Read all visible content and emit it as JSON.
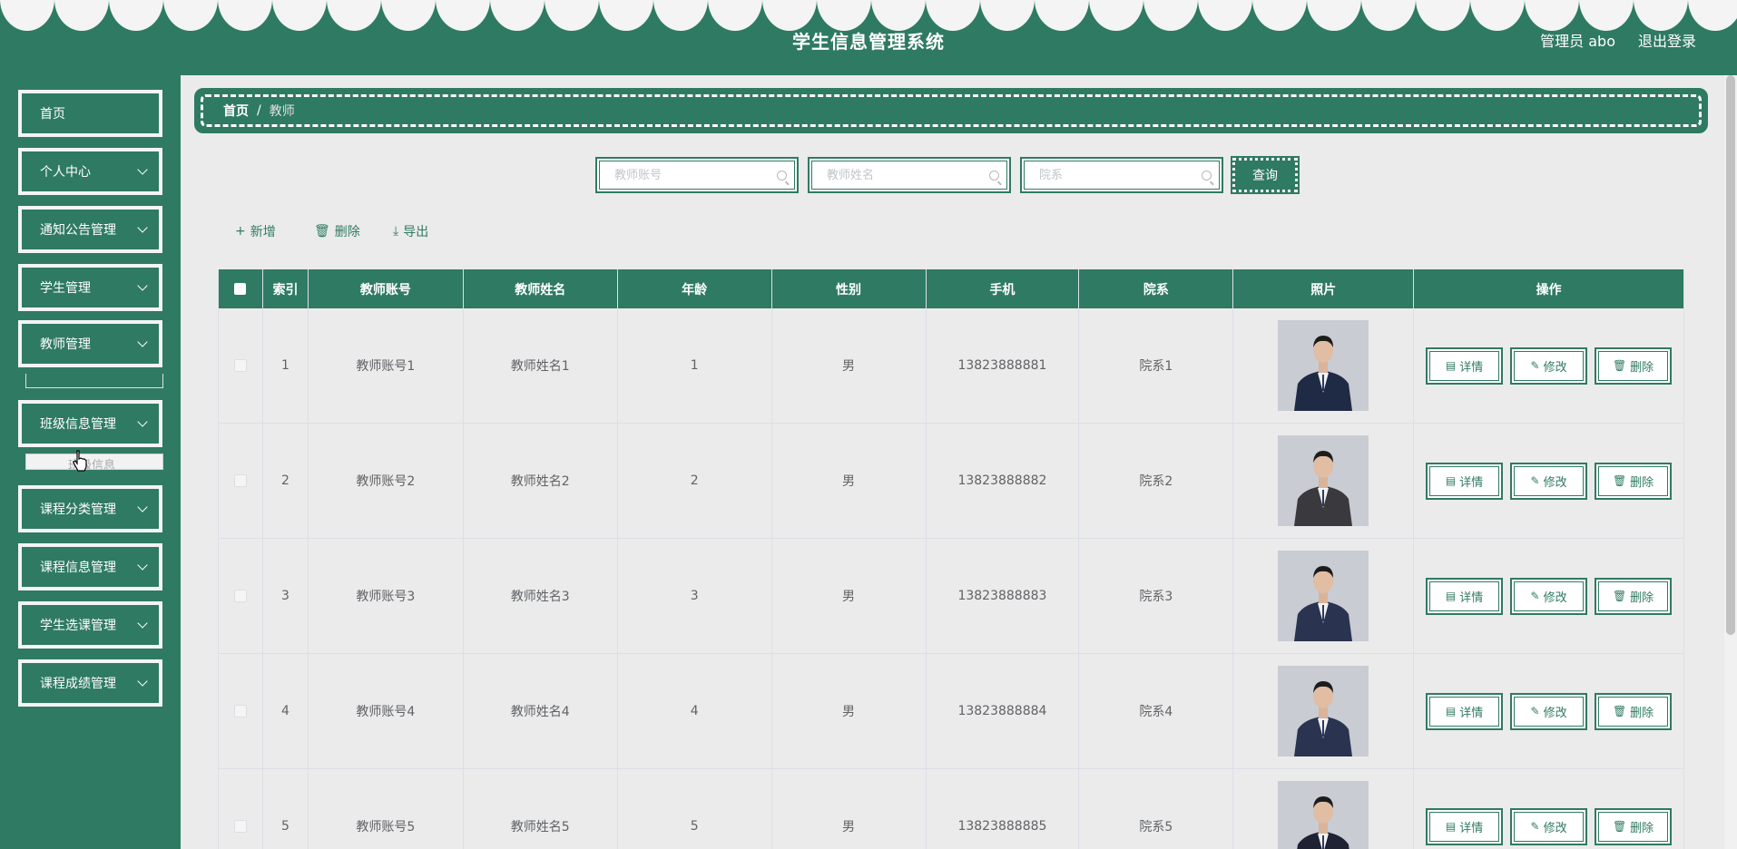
{
  "header": {
    "title": "学生信息管理系统",
    "user": "管理员 abo",
    "logout": "退出登录",
    "color": "#2f7a62"
  },
  "sidebar": {
    "items": [
      {
        "label": "首页",
        "has_arrow": false
      },
      {
        "label": "个人中心",
        "has_arrow": true
      },
      {
        "label": "通知公告管理",
        "has_arrow": true
      },
      {
        "label": "学生管理",
        "has_arrow": true
      },
      {
        "label": "教师管理",
        "has_arrow": true
      },
      {
        "label": "班级信息管理",
        "has_arrow": true
      },
      {
        "label": "课程分类管理",
        "has_arrow": true
      },
      {
        "label": "课程信息管理",
        "has_arrow": true
      },
      {
        "label": "学生选课管理",
        "has_arrow": true
      },
      {
        "label": "课程成绩管理",
        "has_arrow": true
      }
    ],
    "submenu_partial": "班级信息"
  },
  "breadcrumb": {
    "home": "首页",
    "separator": "/",
    "current": "教师"
  },
  "search": {
    "account_placeholder": "教师账号",
    "name_placeholder": "教师姓名",
    "dept_placeholder": "院系",
    "query_label": "查询"
  },
  "actions": {
    "add": "新增",
    "delete": "删除",
    "export": "导出"
  },
  "table": {
    "columns": [
      "索引",
      "教师账号",
      "教师姓名",
      "年龄",
      "性别",
      "手机",
      "院系",
      "照片",
      "操作"
    ],
    "rows": [
      {
        "index": "1",
        "account": "教师账号1",
        "name": "教师姓名1",
        "age": "1",
        "gender": "男",
        "phone": "13823888881",
        "dept": "院系1"
      },
      {
        "index": "2",
        "account": "教师账号2",
        "name": "教师姓名2",
        "age": "2",
        "gender": "男",
        "phone": "13823888882",
        "dept": "院系2"
      },
      {
        "index": "3",
        "account": "教师账号3",
        "name": "教师姓名3",
        "age": "3",
        "gender": "男",
        "phone": "13823888883",
        "dept": "院系3"
      },
      {
        "index": "4",
        "account": "教师账号4",
        "name": "教师姓名4",
        "age": "4",
        "gender": "男",
        "phone": "13823888884",
        "dept": "院系4"
      },
      {
        "index": "5",
        "account": "教师账号5",
        "name": "教师姓名5",
        "age": "5",
        "gender": "男",
        "phone": "13823888885",
        "dept": "院系5"
      }
    ],
    "row_actions": {
      "detail": "详情",
      "edit": "修改",
      "delete": "删除"
    }
  }
}
